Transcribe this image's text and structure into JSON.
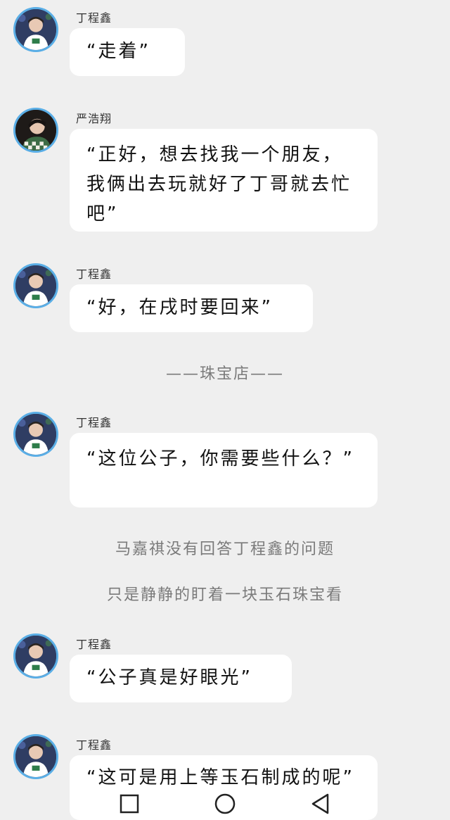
{
  "messages": [
    {
      "name": "丁程鑫",
      "text": "“走着”",
      "avatar": "avatar-dingchengxin"
    },
    {
      "name": "严浩翔",
      "text": "“正好，想去找我一个朋友，我俩出去玩就好了丁哥就去忙吧”",
      "avatar": "avatar-yanhaoxiang"
    },
    {
      "name": "丁程鑫",
      "text": "“好，在戌时要回来”",
      "avatar": "avatar-dingchengxin"
    },
    {
      "name": "丁程鑫",
      "text": "“这位公子，你需要些什么？”",
      "avatar": "avatar-dingchengxin"
    },
    {
      "name": "丁程鑫",
      "text": "“公子真是好眼光”",
      "avatar": "avatar-dingchengxin"
    },
    {
      "name": "丁程鑫",
      "text": "“这可是用上等玉石制成的呢”",
      "avatar": "avatar-dingchengxin"
    }
  ],
  "narration": {
    "scene": "——珠宝店——",
    "line1": "马嘉祺没有回答丁程鑫的问题",
    "line2": "只是静静的盯着一块玉石珠宝看"
  },
  "navbar": {
    "icons": [
      "square-recent-icon",
      "circle-home-icon",
      "triangle-back-icon"
    ]
  },
  "colors": {
    "background": "#efefef",
    "bubble": "#ffffff",
    "avatar_ring": "#5aaee6",
    "narration": "#7a7a7a"
  }
}
